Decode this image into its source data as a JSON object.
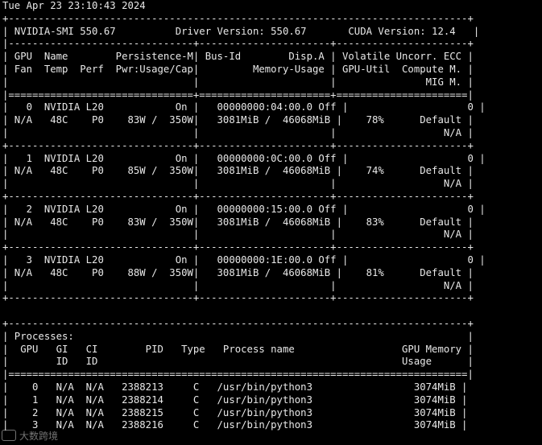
{
  "terminal": {
    "timestamp": "Tue Apr 23 23:10:43 2024",
    "lines": [
      "+-----------------------------------------------------------------------------+",
      "| NVIDIA-SMI 550.67          Driver Version: 550.67       CUDA Version: 12.4   |",
      "|-------------------------------+----------------------+----------------------+",
      "| GPU  Name        Persistence-M| Bus-Id        Disp.A | Volatile Uncorr. ECC |",
      "| Fan  Temp  Perf  Pwr:Usage/Cap|         Memory-Usage | GPU-Util  Compute M. |",
      "|                               |                      |               MIG M. |",
      "|===============================+======================+======================|",
      "|   0  NVIDIA L20            On |   00000000:04:00.0 Off |                    0 |",
      "| N/A   48C    P0    83W /  350W|   3081MiB /  46068MiB |    78%      Default |",
      "|                               |                      |                  N/A |",
      "+-------------------------------+----------------------+----------------------+",
      "|   1  NVIDIA L20            On |   00000000:0C:00.0 Off |                    0 |",
      "| N/A   48C    P0    85W /  350W|   3081MiB /  46068MiB |    74%      Default |",
      "|                               |                      |                  N/A |",
      "+-------------------------------+----------------------+----------------------+",
      "|   2  NVIDIA L20            On |   00000000:15:00.0 Off |                    0 |",
      "| N/A   48C    P0    83W /  350W|   3081MiB /  46068MiB |    83%      Default |",
      "|                               |                      |                  N/A |",
      "+-------------------------------+----------------------+----------------------+",
      "|   3  NVIDIA L20            On |   00000000:1E:00.0 Off |                    0 |",
      "| N/A   48C    P0    88W /  350W|   3081MiB /  46068MiB |    81%      Default |",
      "|                               |                      |                  N/A |",
      "+-------------------------------+----------------------+----------------------+",
      "",
      "+-----------------------------------------------------------------------------+",
      "| Processes:                                                                  |",
      "|  GPU   GI   CI        PID   Type   Process name                  GPU Memory |",
      "|        ID   ID                                                   Usage      |",
      "|=============================================================================|",
      "|    0   N/A  N/A   2388213     C   /usr/bin/python3                 3074MiB |",
      "|    1   N/A  N/A   2388214     C   /usr/bin/python3                 3074MiB |",
      "|    2   N/A  N/A   2388215     C   /usr/bin/python3                 3074MiB |",
      "|    3   N/A  N/A   2388216     C   /usr/bin/python3                 3074MiB |"
    ]
  },
  "watermark": {
    "logo_text": "IC",
    "text": "大数跨境"
  },
  "colors": {
    "background": "#000000",
    "foreground": "#e8e8e8"
  }
}
